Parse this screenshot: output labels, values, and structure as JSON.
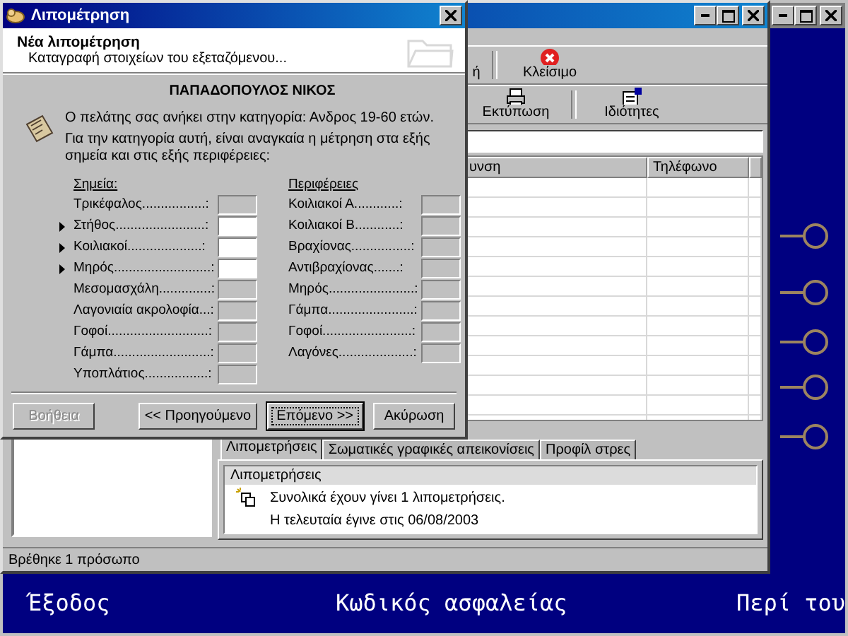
{
  "desktop": {
    "bottom_menu": [
      "Έξοδος",
      "Κωδικός ασφαλείας",
      "Περί του"
    ]
  },
  "main_window": {
    "toolbar_1": [
      {
        "label": "ή"
      },
      {
        "label": "Κλείσιμο"
      }
    ],
    "toolbar_2": [
      {
        "label": "Εκτύπωση"
      },
      {
        "label": "Ιδιότητες"
      }
    ],
    "table": {
      "columns": [
        "υνση",
        "Τηλέφωνο"
      ]
    },
    "tabs": [
      {
        "label": "Λιπομετρήσεις",
        "selected": true
      },
      {
        "label": "Σωματικές γραφικές απεικονίσεις",
        "selected": false
      },
      {
        "label": "Προφίλ στρες",
        "selected": false
      }
    ],
    "panel": {
      "header": "Λιπομετρήσεις",
      "summary": "Συνολικά έχουν γίνει 1 λιπομετρήσεις.",
      "last": "Η τελευταία έγινε στις 06/08/2003"
    },
    "status_bar": "Βρέθηκε 1 πρόσωπο"
  },
  "dialog": {
    "title": "Λιπομέτρηση",
    "header_title": "Νέα λιπομέτρηση",
    "header_subtitle": "Καταγραφή στοιχείων του εξεταζόμενου...",
    "client_name": "ΠΑΠΑΔΟΠΟΥΛΟΣ ΝΙΚΟΣ",
    "messages": [
      "Ο πελάτης σας ανήκει στην κατηγορία: Ανδρος 19-60 ετών.",
      "Για την κατηγορία αυτή, είναι αναγκαία η μέτρηση στα εξής σημεία και στις εξής περιφέρειες:"
    ],
    "points": {
      "heading": "Σημεία:",
      "items": [
        {
          "label": "Τρικέφαλος.................:",
          "active": false
        },
        {
          "label": "Στήθος........................:",
          "active": true
        },
        {
          "label": "Κοιλιακοί....................:",
          "active": true
        },
        {
          "label": "Μηρός..........................:",
          "active": true
        },
        {
          "label": "Μεσομασχάλη..............:",
          "active": false
        },
        {
          "label": "Λαγονιαία ακρολοφία...:",
          "active": false
        },
        {
          "label": "Γοφοί...........................:",
          "active": false
        },
        {
          "label": "Γάμπα..........................:",
          "active": false
        },
        {
          "label": "Υποπλάτιος.................:",
          "active": false
        }
      ]
    },
    "perimeters": {
      "heading": "Περιφέρειες",
      "items": [
        {
          "label": "Κοιλιακοί Α............:",
          "active": false
        },
        {
          "label": "Κοιλιακοί Β............:",
          "active": false
        },
        {
          "label": "Βραχίονας................:",
          "active": false
        },
        {
          "label": "Αντιβραχίονας.......:",
          "active": false
        },
        {
          "label": "Μηρός.......................:",
          "active": false
        },
        {
          "label": "Γάμπα.......................:",
          "active": false
        },
        {
          "label": "Γοφοί........................:",
          "active": false
        },
        {
          "label": "Λαγόνες....................:",
          "active": false
        }
      ]
    },
    "buttons": [
      {
        "label": "Βοήθεια",
        "disabled": true,
        "default": false
      },
      {
        "label": "<< Προηγούμενο",
        "disabled": false,
        "default": false
      },
      {
        "label": "Επόμενο >>",
        "disabled": false,
        "default": true
      },
      {
        "label": "Ακύρωση",
        "disabled": false,
        "default": false
      }
    ]
  }
}
